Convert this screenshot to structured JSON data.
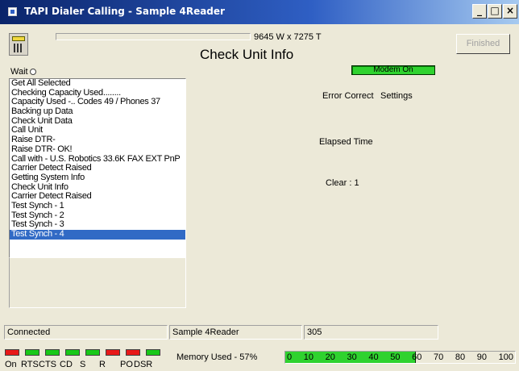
{
  "window": {
    "title": "TAPI Dialer  Calling - Sample 4Reader",
    "buttons": {
      "minimize": "_",
      "maximize": "□",
      "close": "×"
    }
  },
  "header": {
    "size_text": "9645 W x 7275 T",
    "page_title": "Check Unit Info",
    "finished_label": "Finished",
    "modem_status": "Modem On",
    "wait_label": "Wait"
  },
  "log_items": [
    "Get All Selected",
    "Checking Capacity Used........",
    "Capacity Used -.. Codes 49 / Phones 37",
    "Backing up Data",
    "Check Unit Data",
    "Call Unit",
    " Raise DTR-",
    " Raise DTR- OK!",
    "Call with - U.S. Robotics 33.6K FAX EXT PnP",
    "Carrier Detect Raised",
    "Getting System Info",
    "Check Unit Info",
    "Carrier Detect Raised",
    "Test Synch - 1",
    "Test Synch - 2",
    "Test Synch - 3",
    "Test Synch - 4"
  ],
  "selected_index": 16,
  "info": {
    "error_correct": "Error Correct",
    "settings": "Settings",
    "elapsed_time": "Elapsed Time",
    "clear": "Clear : 1"
  },
  "status": {
    "connection": "Connected",
    "device": "Sample 4Reader",
    "number": "305"
  },
  "signals": [
    {
      "label": "On",
      "color": "#e81818"
    },
    {
      "label": "RTS",
      "color": "#18c818"
    },
    {
      "label": "CTS",
      "color": "#18c818"
    },
    {
      "label": "CD",
      "color": "#18c818"
    },
    {
      "label": "S",
      "color": "#18c818"
    },
    {
      "label": "R",
      "color": "#e81818"
    },
    {
      "label": "PO",
      "color": "#e81818"
    },
    {
      "label": "DSR",
      "color": "#18c818"
    }
  ],
  "memory": {
    "label": "Memory Used - 57%",
    "percent": 57,
    "ticks": [
      "0",
      "10",
      "20",
      "30",
      "40",
      "50",
      "60",
      "70",
      "80",
      "90",
      "100"
    ]
  }
}
